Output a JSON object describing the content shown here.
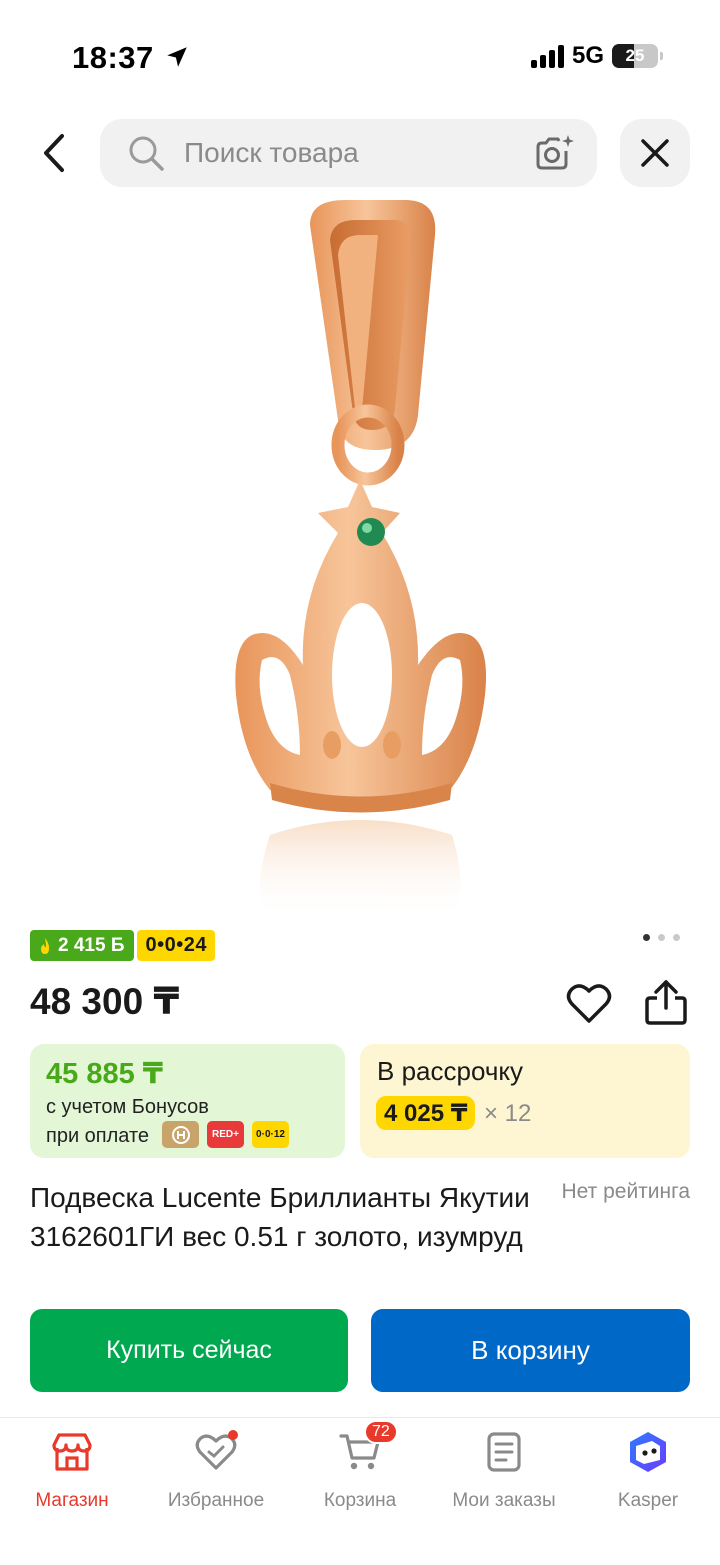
{
  "status_bar": {
    "time": "18:37",
    "network": "5G",
    "battery": "25"
  },
  "header": {
    "search_placeholder": "Поиск товара",
    "icons": [
      "back-arrow-icon",
      "search-icon",
      "camera-ai-icon",
      "close-icon"
    ]
  },
  "gallery": {
    "image_count": 3,
    "active_index": 0
  },
  "badges": {
    "bonus": "2 415 Б",
    "installment": "0•0•24"
  },
  "product": {
    "price": "48 300 ₸",
    "title": "Подвеска Lucente Бриллианты Якутии 3162601ГИ вес 0.51 г золото, изумруд",
    "rating": "Нет рейтинга"
  },
  "bonus_offer": {
    "price": "45 885 ₸",
    "line1": "с учетом Бонусов",
    "line2": "при оплате",
    "pay_methods": [
      "kaspi-gold-icon",
      "RED+",
      "0·0·12"
    ]
  },
  "installment_offer": {
    "label": "В рассрочку",
    "amount": "4 025 ₸",
    "times": "× 12"
  },
  "actions": {
    "buy_now": "Купить сейчас",
    "add_to_cart": "В корзину"
  },
  "tabbar": {
    "tabs": [
      {
        "label": "Магазин",
        "icon": "store-icon",
        "active": true
      },
      {
        "label": "Избранное",
        "icon": "heart-icon"
      },
      {
        "label": "Корзина",
        "icon": "cart-icon",
        "badge": "72"
      },
      {
        "label": "Мои заказы",
        "icon": "orders-icon"
      },
      {
        "label": "Kasper",
        "icon": "kasper-assistant-icon"
      }
    ]
  },
  "colors": {
    "green": "#00a84f",
    "blue": "#0069c8",
    "bonus_green": "#4aa81b",
    "yellow": "#ffd700",
    "accent_red": "#e8392b"
  }
}
